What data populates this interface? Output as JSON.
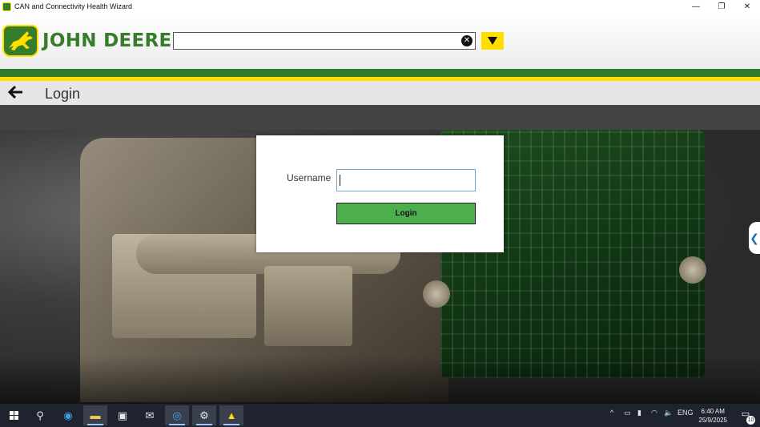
{
  "window": {
    "title": "CAN and Connectivity Health Wizard",
    "min_glyph": "—",
    "max_glyph": "❐",
    "close_glyph": "✕"
  },
  "header": {
    "brand": "JOHN DEERE",
    "search": {
      "value": "",
      "placeholder": "",
      "clear_glyph": "✕"
    },
    "colors": {
      "brand_green": "#367c2b",
      "brand_yellow": "#ffde00"
    }
  },
  "nav": {
    "back_glyph": "🡐",
    "page_title": "Login"
  },
  "login": {
    "username_label": "Username",
    "username_value": "",
    "button_label": "Login"
  },
  "side_tab_glyph": "❮",
  "taskbar": {
    "items": [
      {
        "name": "start",
        "icon": "windows-icon"
      },
      {
        "name": "search",
        "icon": "search-icon",
        "glyph": "⚲"
      },
      {
        "name": "edge",
        "icon": "edge-icon",
        "glyph": "◉"
      },
      {
        "name": "file-explorer",
        "icon": "folder-icon",
        "glyph": "▬"
      },
      {
        "name": "store",
        "icon": "store-icon",
        "glyph": "▣"
      },
      {
        "name": "mail",
        "icon": "mail-icon",
        "glyph": "✉"
      },
      {
        "name": "app-blue",
        "icon": "app-icon",
        "glyph": "◎"
      },
      {
        "name": "settings",
        "icon": "gear-icon",
        "glyph": "⚙"
      },
      {
        "name": "john-deere",
        "icon": "john-deere-icon",
        "glyph": "▲"
      }
    ],
    "tray": {
      "chevron_glyph": "^",
      "language": "ENG",
      "time": "6:40 AM",
      "date": "25/9/2025",
      "notification_count": "10"
    }
  }
}
